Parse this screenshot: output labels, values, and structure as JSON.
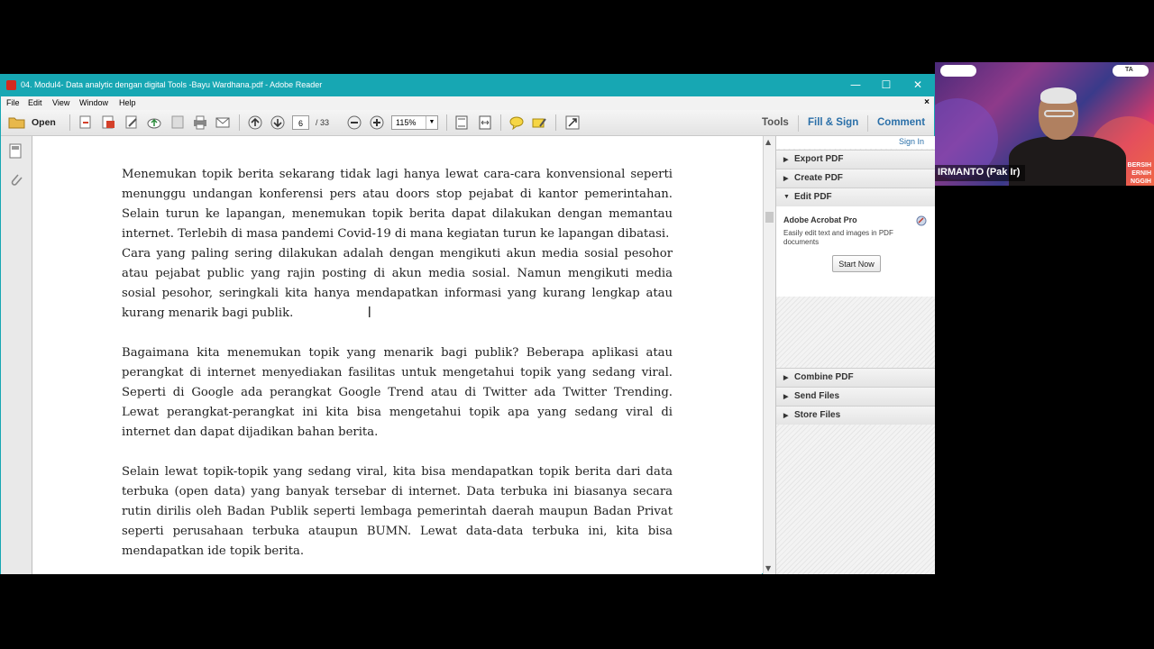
{
  "window": {
    "title": "04. Modul4- Data analytic dengan digital Tools -Bayu Wardhana.pdf - Adobe Reader",
    "controls": {
      "minimize": "—",
      "maximize": "☐",
      "close": "✕"
    }
  },
  "menu": {
    "items": [
      "File",
      "Edit",
      "View",
      "Window",
      "Help"
    ],
    "close_doc": "×"
  },
  "toolbar": {
    "open_label": "Open",
    "page_current": "6",
    "page_total": "/ 33",
    "zoom": "115%",
    "tools_label": "Tools",
    "fill_sign_label": "Fill & Sign",
    "comment_label": "Comment"
  },
  "document": {
    "paragraphs": [
      "Menemukan topik berita sekarang tidak lagi hanya lewat cara-cara konvensional seperti menunggu undangan konferensi pers atau doors stop pejabat di kantor pemerintahan. Selain turun ke lapangan, menemukan topik berita dapat dilakukan dengan memantau internet. Terlebih di masa pandemi Covid-19 di mana kegiatan turun ke lapangan dibatasi.",
      "Cara yang paling sering dilakukan adalah dengan mengikuti akun media sosial pesohor atau pejabat public yang rajin posting di akun media sosial. Namun mengikuti media sosial pesohor, seringkali kita hanya mendapatkan informasi yang kurang lengkap atau kurang menarik bagi publik.",
      "Bagaimana kita menemukan topik yang menarik bagi publik? Beberapa aplikasi atau perangkat di internet menyediakan fasilitas  untuk mengetahui topik yang sedang viral. Seperti di Google ada perangkat Google Trend atau di Twitter ada Twitter Trending. Lewat perangkat-perangkat ini kita bisa mengetahui topik apa yang sedang viral di internet dan dapat dijadikan bahan berita.",
      "Selain lewat topik-topik yang sedang viral, kita bisa mendapatkan topik berita dari data terbuka (open data) yang banyak tersebar di internet.  Data terbuka ini biasanya secara rutin dirilis oleh Badan Publik seperti lembaga pemerintah daerah maupun Badan Privat seperti perusahaan terbuka ataupun BUMN. Lewat data-data terbuka ini, kita bisa mendapatkan ide topik berita."
    ]
  },
  "right_panel": {
    "sign_in": "Sign In",
    "sections": [
      "Export PDF",
      "Create PDF",
      "Edit PDF"
    ],
    "edit_pdf": {
      "title": "Adobe Acrobat Pro",
      "description": "Easily edit text and images in PDF documents",
      "button": "Start Now"
    },
    "sections_after": [
      "Combine PDF",
      "Send Files",
      "Store Files"
    ]
  },
  "video": {
    "participant_name": "IRMANTO (Pak Ir)",
    "logo_right": "TA",
    "bg_text": "BERSIH\nERNIH\nNGGIH"
  }
}
